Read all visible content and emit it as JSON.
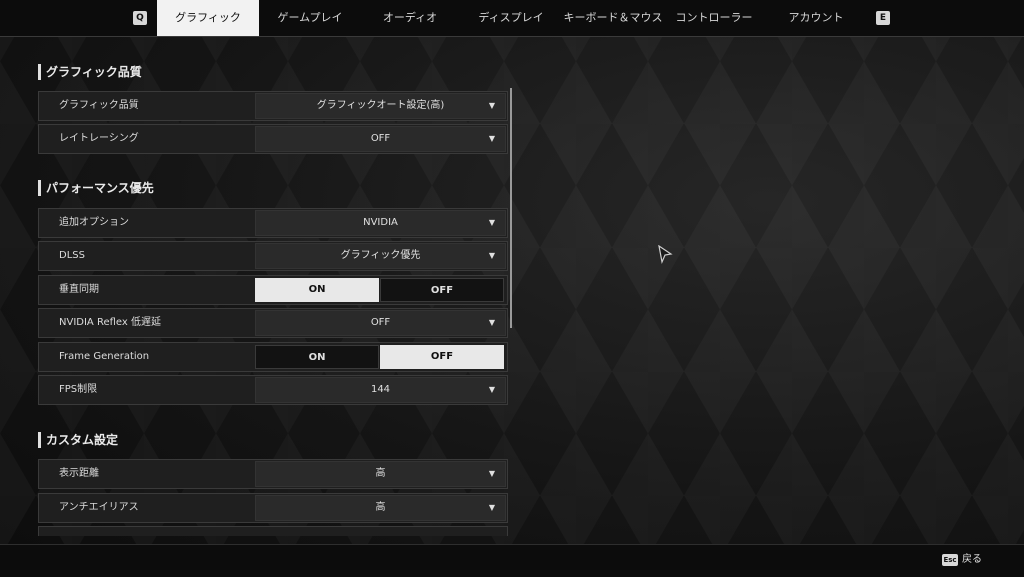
{
  "tabs": {
    "prev_key": "Q",
    "next_key": "E",
    "items": [
      "グラフィック",
      "ゲームプレイ",
      "オーディオ",
      "ディスプレイ",
      "キーボード＆マウス",
      "コントローラー",
      "アカウント"
    ],
    "active": "グラフィック"
  },
  "sections": {
    "quality": {
      "title": "グラフィック品質",
      "rows": [
        {
          "label": "グラフィック品質",
          "value": "グラフィックオート設定(高)"
        },
        {
          "label": "レイトレーシング",
          "value": "OFF"
        }
      ]
    },
    "performance": {
      "title": "パフォーマンス優先",
      "rows": [
        {
          "label": "追加オプション",
          "value": "NVIDIA"
        },
        {
          "label": "DLSS",
          "value": "グラフィック優先"
        },
        {
          "label": "垂直同期",
          "on": "ON",
          "off": "OFF",
          "selected": "ON"
        },
        {
          "label": "NVIDIA Reflex 低遅延",
          "value": "OFF"
        },
        {
          "label": "Frame Generation",
          "on": "ON",
          "off": "OFF",
          "selected": "OFF"
        },
        {
          "label": "FPS制限",
          "value": "144"
        }
      ]
    },
    "custom": {
      "title": "カスタム設定",
      "rows": [
        {
          "label": "表示距離",
          "value": "高"
        },
        {
          "label": "アンチエイリアス",
          "value": "高"
        }
      ]
    }
  },
  "footer": {
    "esc_key": "Esc",
    "back_label": "戻る"
  },
  "icons": {
    "dropdown": "caret-down-icon",
    "cursor": "mouse-cursor-icon"
  }
}
